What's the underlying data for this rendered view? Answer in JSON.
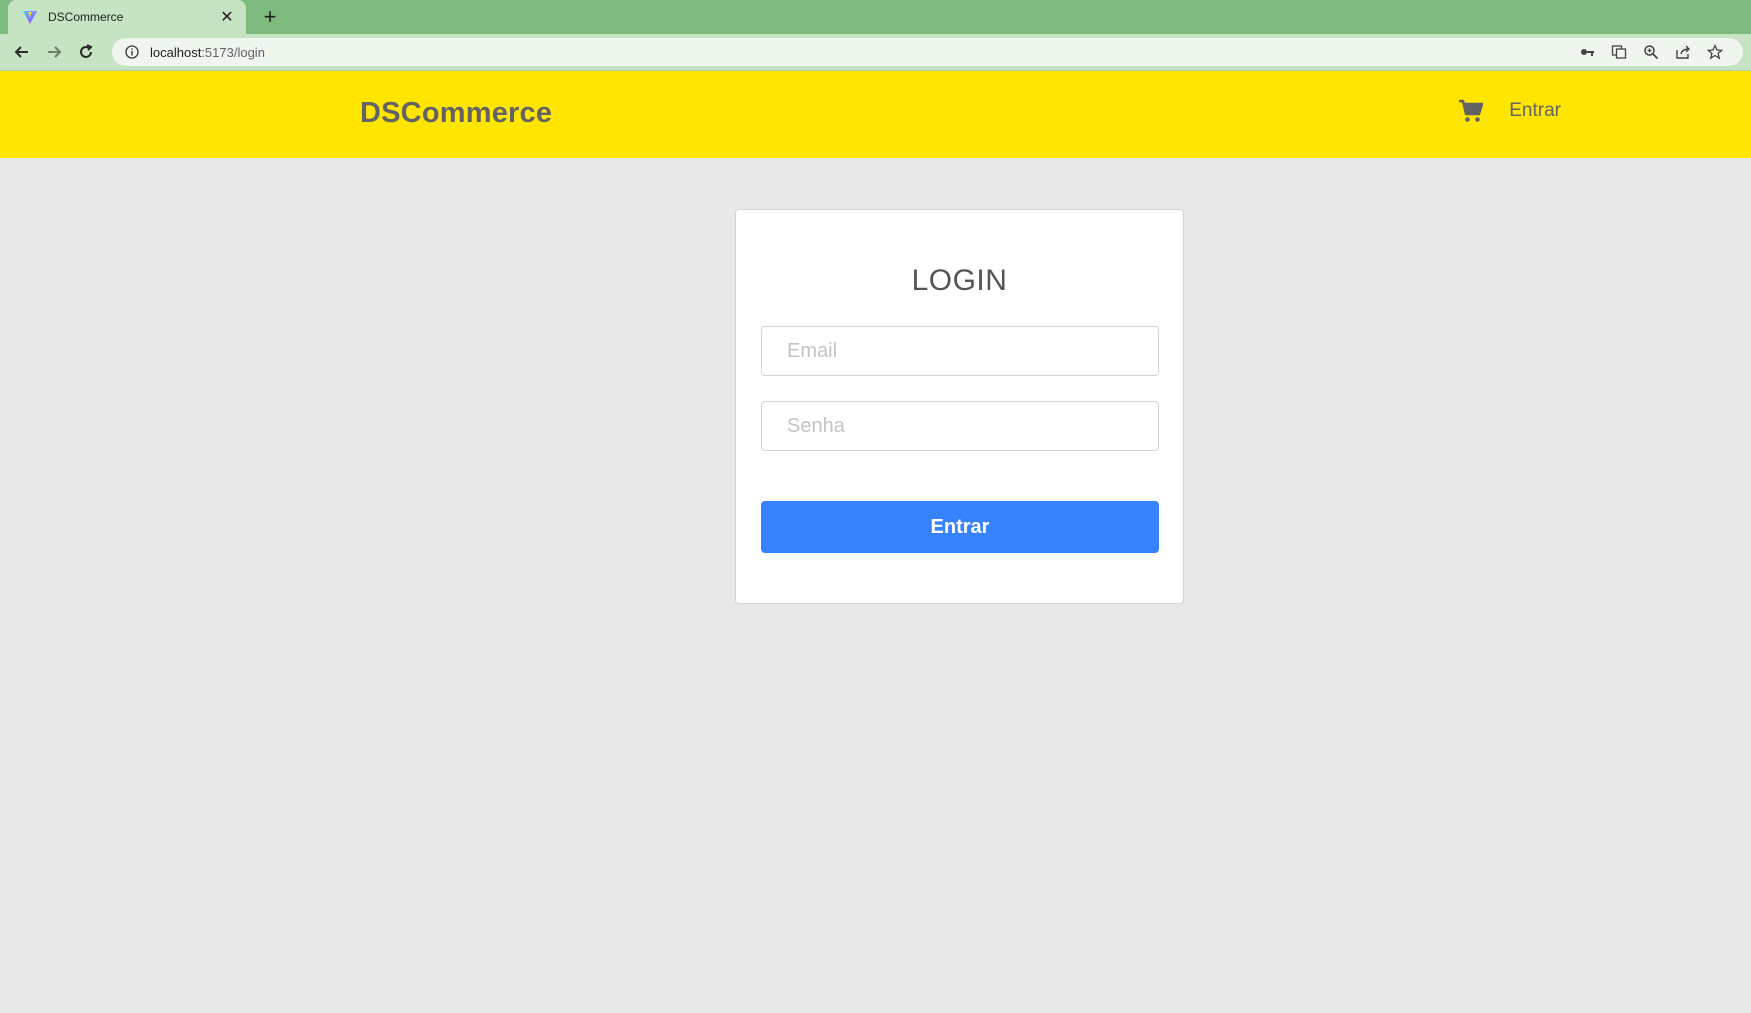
{
  "browser": {
    "tab_title": "DSCommerce",
    "url_host": "localhost",
    "url_path": ":5173/login",
    "colors": {
      "tabstrip": "#7cbb7d",
      "toolbar": "#c6e3c4"
    }
  },
  "header": {
    "logo": "DSCommerce",
    "login_link": "Entrar",
    "cart_icon": "cart-icon",
    "background": "#ffe500"
  },
  "login": {
    "title": "LOGIN",
    "email_placeholder": "Email",
    "password_placeholder": "Senha",
    "submit_label": "Entrar",
    "button_color": "#3783fd"
  }
}
